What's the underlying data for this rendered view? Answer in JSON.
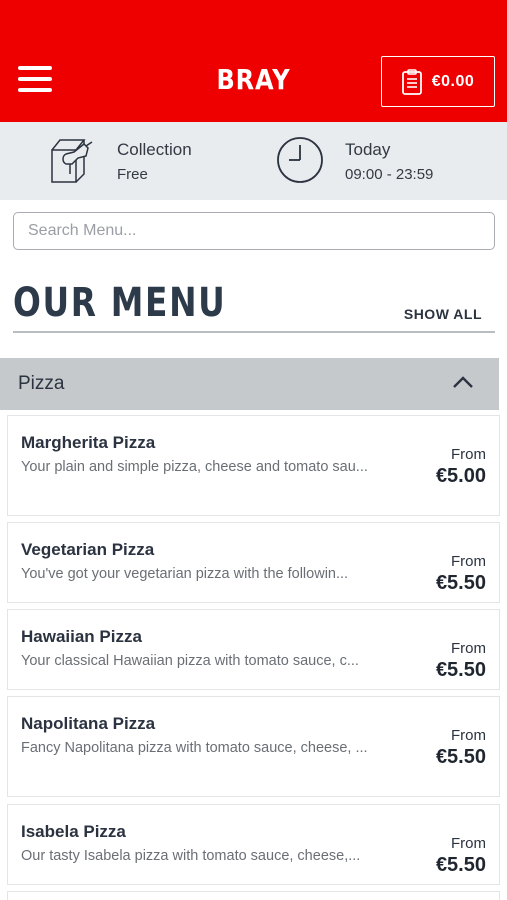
{
  "header": {
    "brand": "BRAY",
    "cart_total": "€0.00",
    "menu_icon": "hamburger-icon",
    "cart_icon": "clipboard-icon",
    "color": "#ee0000"
  },
  "info": {
    "collection_title": "Collection",
    "collection_sub": "Free",
    "collection_icon": "bag-icon",
    "time_title": "Today",
    "time_sub": "09:00 - 23:59",
    "time_icon": "clock-icon"
  },
  "search": {
    "placeholder": "Search Menu..."
  },
  "menu": {
    "title": "OUR MENU",
    "show_all": "SHOW ALL",
    "category": "Pizza",
    "category_icon": "chevron-up-icon",
    "items": [
      {
        "name": "Margherita Pizza",
        "desc": "Your plain and simple pizza, cheese and tomato sau...",
        "from": "From",
        "price": "€5.00"
      },
      {
        "name": "Vegetarian Pizza",
        "desc": "You've got your vegetarian pizza with the followin...",
        "from": "From",
        "price": "€5.50"
      },
      {
        "name": "Hawaiian Pizza",
        "desc": "Your classical Hawaiian pizza with tomato sauce, c...",
        "from": "From",
        "price": "€5.50"
      },
      {
        "name": "Napolitana Pizza",
        "desc": "Fancy Napolitana pizza with tomato sauce, cheese, ...",
        "from": "From",
        "price": "€5.50"
      },
      {
        "name": "Isabela Pizza",
        "desc": "Our tasty Isabela pizza with tomato sauce, cheese,...",
        "from": "From",
        "price": "€5.50"
      }
    ]
  }
}
